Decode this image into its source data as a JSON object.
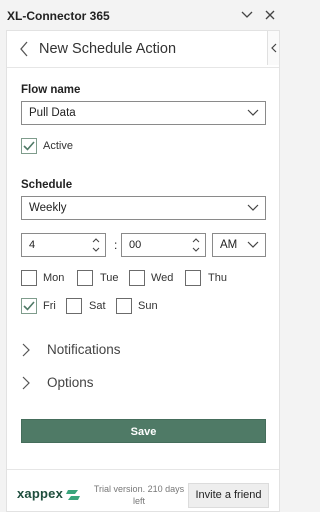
{
  "app": {
    "title": "XL-Connector 365"
  },
  "header": {
    "title": "New Schedule Action"
  },
  "flow": {
    "label": "Flow name",
    "selected": "Pull Data",
    "active_label": "Active",
    "active_checked": true
  },
  "schedule": {
    "label": "Schedule",
    "frequency": "Weekly",
    "hour": "4",
    "separator": ":",
    "minute": "00",
    "ampm": "AM",
    "days": [
      {
        "label": "Mon",
        "checked": false
      },
      {
        "label": "Tue",
        "checked": false
      },
      {
        "label": "Wed",
        "checked": false
      },
      {
        "label": "Thu",
        "checked": false
      },
      {
        "label": "Fri",
        "checked": true
      },
      {
        "label": "Sat",
        "checked": false
      },
      {
        "label": "Sun",
        "checked": false
      }
    ]
  },
  "sections": {
    "notifications": "Notifications",
    "options": "Options"
  },
  "actions": {
    "save": "Save"
  },
  "footer": {
    "logo": "xappex",
    "trial": "Trial version. 210 days left",
    "invite": "Invite a friend"
  },
  "colors": {
    "accent": "#4f7a66",
    "check": "#4f7a66",
    "logo": "#1f4e3d"
  }
}
